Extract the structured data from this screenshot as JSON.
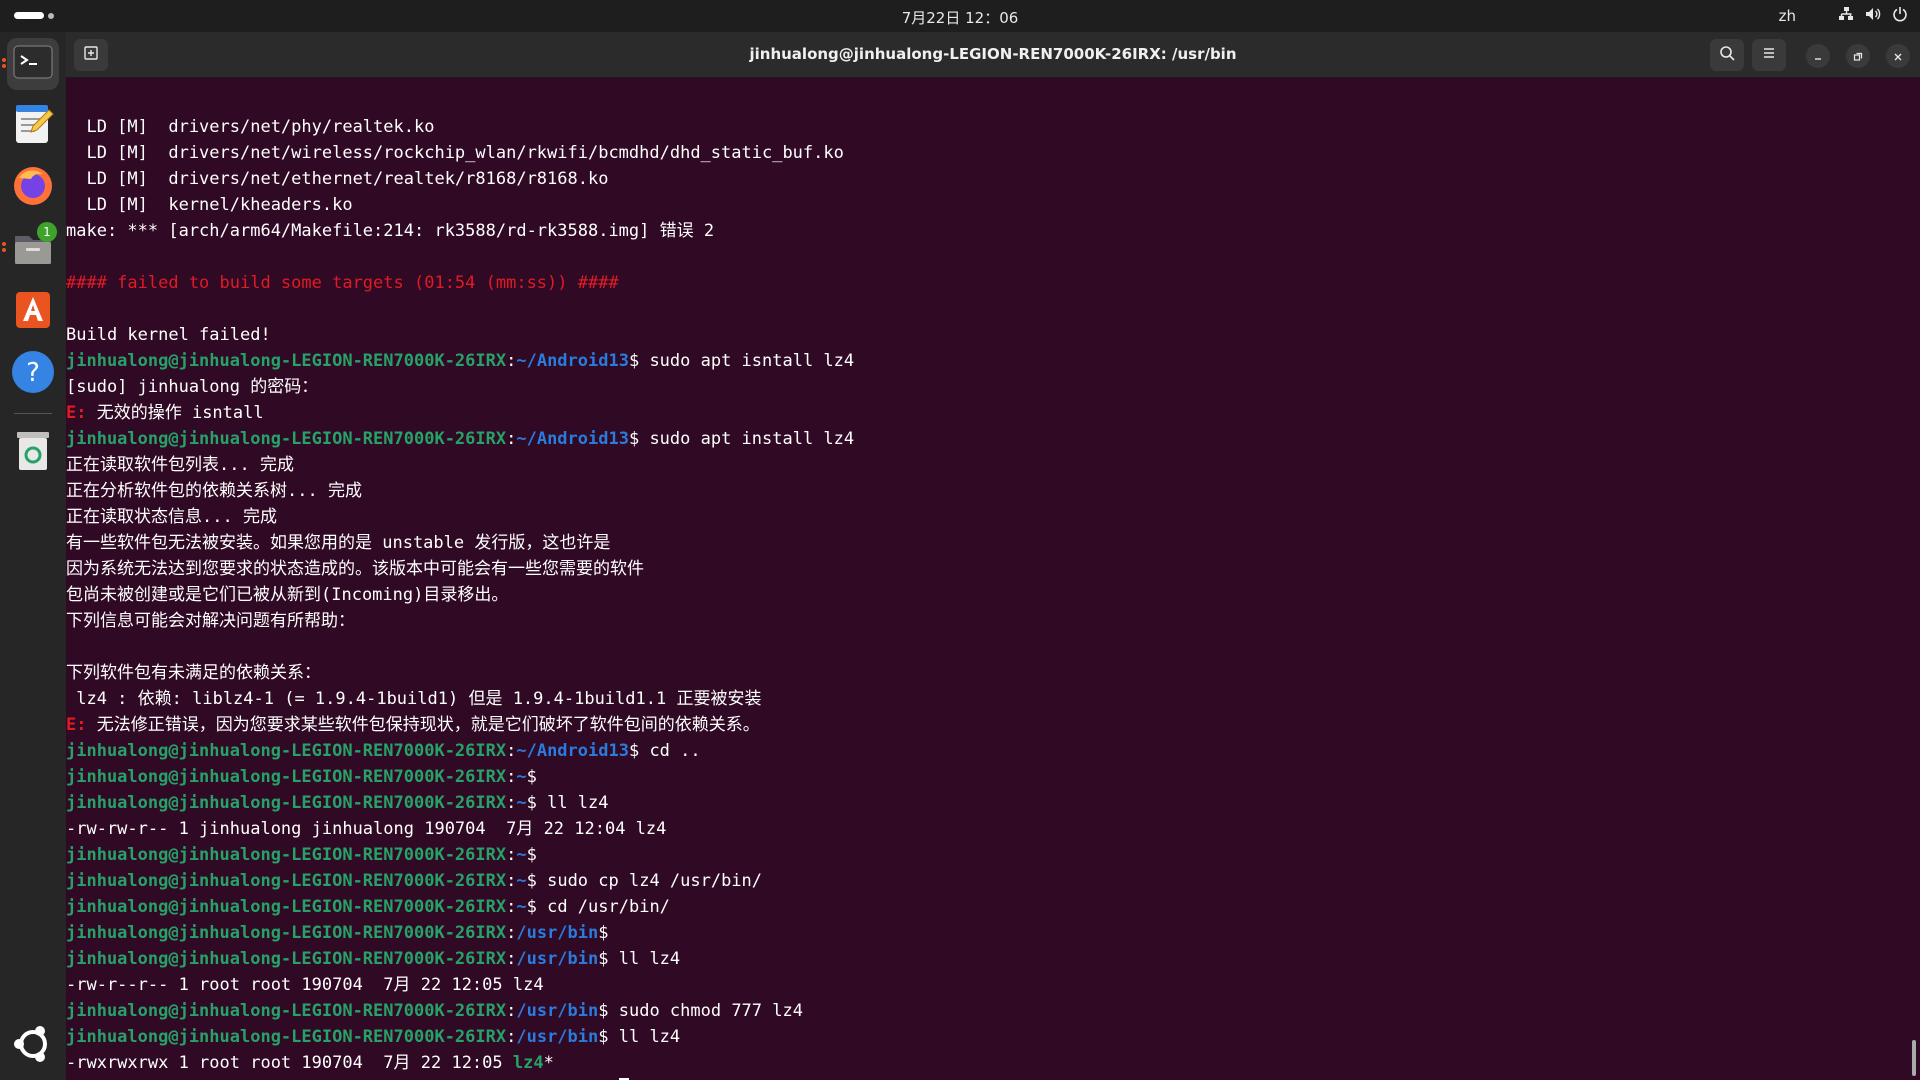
{
  "topbar": {
    "clock": "7月22日  12：06",
    "lang": "zh",
    "icons": [
      "network-icon",
      "volume-icon",
      "power-icon"
    ]
  },
  "dock": {
    "items": [
      {
        "name": "terminal",
        "icon": "terminal-icon",
        "active": true
      },
      {
        "name": "text-editor",
        "icon": "text-editor-icon"
      },
      {
        "name": "firefox",
        "icon": "firefox-icon"
      },
      {
        "name": "files",
        "icon": "files-icon",
        "badge": "1"
      },
      {
        "name": "app-center",
        "icon": "app-center-icon"
      },
      {
        "name": "help",
        "icon": "help-icon"
      },
      {
        "name": "trash",
        "icon": "trash-icon"
      },
      {
        "name": "show-apps",
        "icon": "ubuntu-logo-icon"
      }
    ]
  },
  "window": {
    "title": "jinhualong@jinhualong-LEGION-REN7000K-26IRX: /usr/bin"
  },
  "colors": {
    "background": "#300a24",
    "user": "#26a269",
    "path": "#2a7bde",
    "error": "#e01b24"
  },
  "terminal": {
    "user": "jinhualong@jinhualong-LEGION-REN7000K-26IRX",
    "lines": [
      {
        "t": "  LD [M]  drivers/net/phy/realtek.ko"
      },
      {
        "t": "  LD [M]  drivers/net/wireless/rockchip_wlan/rkwifi/bcmdhd/dhd_static_buf.ko"
      },
      {
        "t": "  LD [M]  drivers/net/ethernet/realtek/r8168/r8168.ko"
      },
      {
        "t": "  LD [M]  kernel/kheaders.ko"
      },
      {
        "t": "make: *** [arch/arm64/Makefile:214: rk3588/rd-rk3588.img] 错误 2"
      },
      {
        "t": ""
      },
      {
        "t": "#### failed to build some targets (01:54 (mm:ss)) ####",
        "style": "red"
      },
      {
        "t": ""
      },
      {
        "t": "Build kernel failed!"
      },
      {
        "prompt": true,
        "path": "~/Android13",
        "cmd": " sudo apt isntall lz4"
      },
      {
        "t": "[sudo] jinhualong 的密码："
      },
      {
        "err": "E: ",
        "t": "无效的操作 isntall"
      },
      {
        "prompt": true,
        "path": "~/Android13",
        "cmd": " sudo apt install lz4"
      },
      {
        "t": "正在读取软件包列表... 完成"
      },
      {
        "t": "正在分析软件包的依赖关系树... 完成"
      },
      {
        "t": "正在读取状态信息... 完成"
      },
      {
        "t": "有一些软件包无法被安装。如果您用的是 unstable 发行版，这也许是"
      },
      {
        "t": "因为系统无法达到您要求的状态造成的。该版本中可能会有一些您需要的软件"
      },
      {
        "t": "包尚未被创建或是它们已被从新到(Incoming)目录移出。"
      },
      {
        "t": "下列信息可能会对解决问题有所帮助："
      },
      {
        "t": ""
      },
      {
        "t": "下列软件包有未满足的依赖关系："
      },
      {
        "t": " lz4 : 依赖: liblz4-1 (= 1.9.4-1build1) 但是 1.9.4-1build1.1 正要被安装"
      },
      {
        "err": "E: ",
        "t": "无法修正错误，因为您要求某些软件包保持现状，就是它们破坏了软件包间的依赖关系。"
      },
      {
        "prompt": true,
        "path": "~/Android13",
        "cmd": " cd .."
      },
      {
        "prompt": true,
        "path": "~",
        "cmd": ""
      },
      {
        "prompt": true,
        "path": "~",
        "cmd": " ll lz4"
      },
      {
        "t": "-rw-rw-r-- 1 jinhualong jinhualong 190704  7月 22 12:04 lz4"
      },
      {
        "prompt": true,
        "path": "~",
        "cmd": ""
      },
      {
        "prompt": true,
        "path": "~",
        "cmd": " sudo cp lz4 /usr/bin/"
      },
      {
        "prompt": true,
        "path": "~",
        "cmd": " cd /usr/bin/"
      },
      {
        "prompt": true,
        "path": "/usr/bin",
        "cmd": ""
      },
      {
        "prompt": true,
        "path": "/usr/bin",
        "cmd": " ll lz4"
      },
      {
        "t": "-rw-r--r-- 1 root root 190704  7月 22 12:05 lz4"
      },
      {
        "prompt": true,
        "path": "/usr/bin",
        "cmd": " sudo chmod 777 lz4"
      },
      {
        "prompt": true,
        "path": "/usr/bin",
        "cmd": " ll lz4"
      },
      {
        "t": "-rwxrwxrwx 1 root root 190704  7月 22 12:05 ",
        "exe": "lz4",
        "tail": "*"
      },
      {
        "prompt": true,
        "path": "/usr/bin",
        "cmd": " ",
        "cursor": true
      }
    ]
  }
}
